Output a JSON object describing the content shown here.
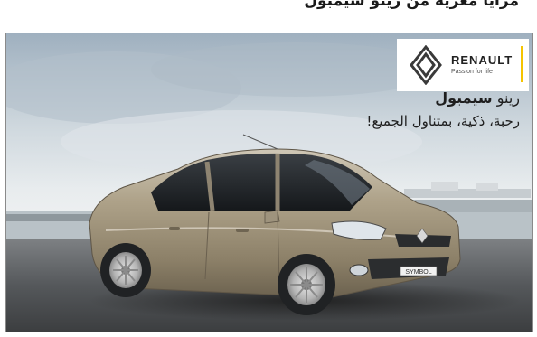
{
  "page_caption": "مزايا مغرية من رينو سيمبول",
  "ad": {
    "brand": {
      "name": "RENAULT",
      "tagline": "Passion for life",
      "accent_color": "#f5c400",
      "logo_icon": "renault-diamond-icon"
    },
    "headline": {
      "prefix": "رينو",
      "model": "سيمبول"
    },
    "subheadline": "رحبة، ذكية، بمتناول الجميع!",
    "car": {
      "description": "Renault Symbol sedan",
      "body_color": "#a89c87",
      "plate_text": "SYMBOL"
    }
  }
}
